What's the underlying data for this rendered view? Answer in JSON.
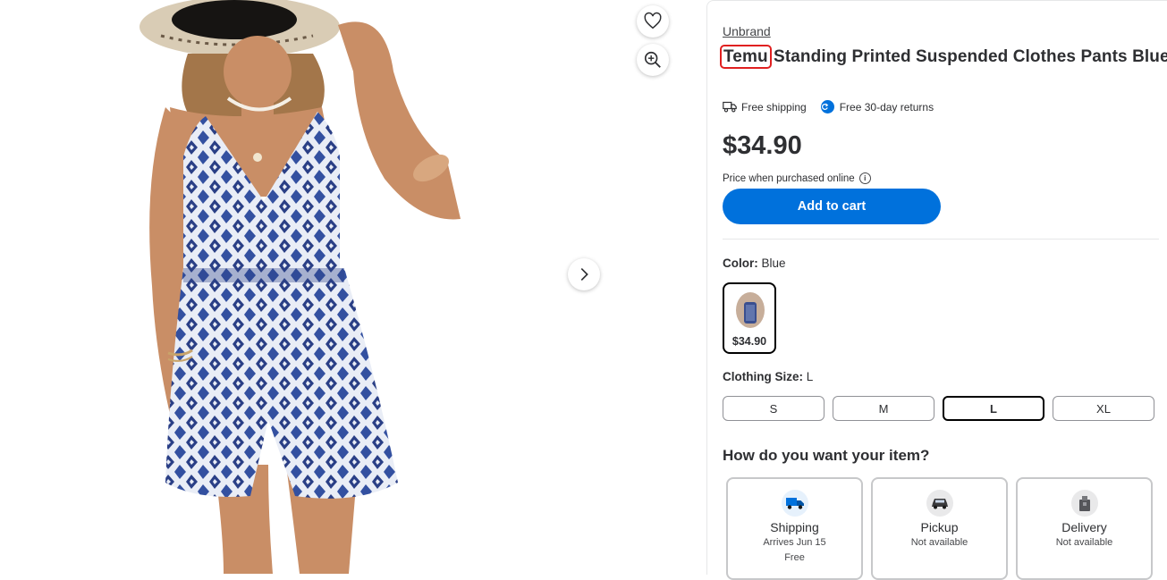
{
  "gallery": {
    "favorite_icon": "heart-icon",
    "zoom_icon": "zoom-in-icon",
    "next_icon": "chevron-right-icon"
  },
  "product": {
    "brand": "Unbrand",
    "title_highlight": "Temu",
    "title_rest": " Standing Printed Suspended Clothes Pants Blue L",
    "free_shipping": "Free shipping",
    "free_returns": "Free 30-day returns",
    "price": "$34.90",
    "price_note": "Price when purchased online",
    "add_to_cart": "Add to cart"
  },
  "color": {
    "label": "Color:",
    "value": "Blue",
    "swatch_price": "$34.90"
  },
  "size": {
    "label": "Clothing Size:",
    "value": "L",
    "options": [
      "S",
      "M",
      "L",
      "XL"
    ],
    "selected": "L"
  },
  "fulfillment": {
    "title": "How do you want your item?",
    "options": [
      {
        "name": "Shipping",
        "line1": "Arrives Jun 15",
        "line2": "Free",
        "icon": "truck-icon"
      },
      {
        "name": "Pickup",
        "line1": "Not available",
        "line2": "",
        "icon": "car-icon"
      },
      {
        "name": "Delivery",
        "line1": "Not available",
        "line2": "",
        "icon": "bag-icon"
      }
    ]
  },
  "colors": {
    "accent": "#0071dc",
    "highlight_box": "#e02020",
    "text": "#2e2f32"
  }
}
